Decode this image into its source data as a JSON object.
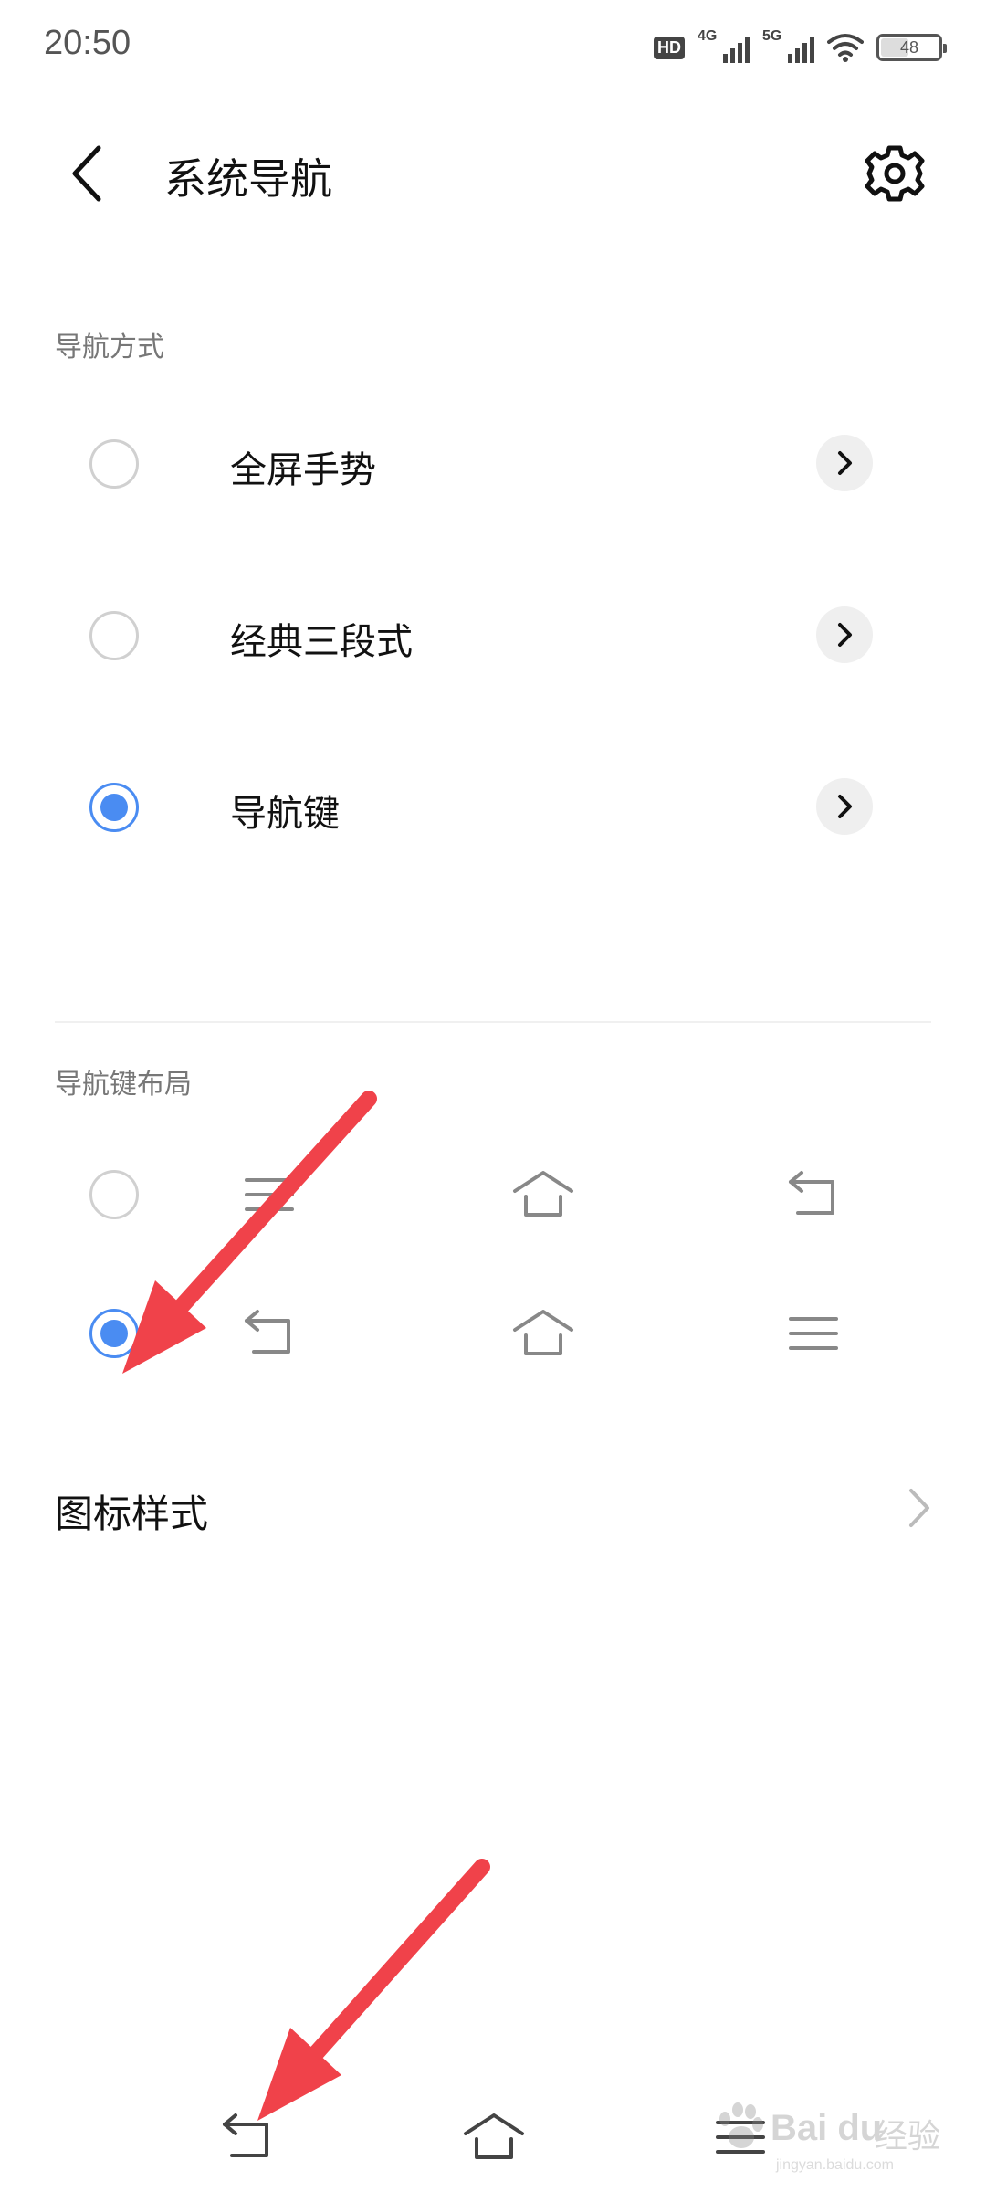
{
  "status_bar": {
    "time": "20:50",
    "hd_label": "HD",
    "network_1": "4G",
    "network_2": "5G",
    "battery": "48",
    "battery_level": 0.48
  },
  "header": {
    "title": "系统导航",
    "back_icon": "chevron-left-icon",
    "settings_icon": "gear-icon"
  },
  "navigation_mode": {
    "section_label": "导航方式",
    "options": [
      {
        "label": "全屏手势",
        "selected": false
      },
      {
        "label": "经典三段式",
        "selected": false
      },
      {
        "label": "导航键",
        "selected": true
      }
    ]
  },
  "key_layout": {
    "section_label": "导航键布局",
    "rows": [
      {
        "selected": false,
        "icons": [
          "menu-icon",
          "home-icon",
          "back-icon"
        ]
      },
      {
        "selected": true,
        "icons": [
          "back-icon",
          "home-icon",
          "menu-icon"
        ]
      }
    ]
  },
  "icon_style": {
    "label": "图标样式"
  },
  "system_nav_bar": {
    "icons": [
      "back-icon",
      "home-icon",
      "menu-icon"
    ]
  },
  "colors": {
    "accent": "#4a8cf2",
    "annotation_arrow": "#f0424a"
  },
  "watermark": {
    "brand": "Bai du",
    "suffix": "经验",
    "url": "jingyan.baidu.com"
  }
}
